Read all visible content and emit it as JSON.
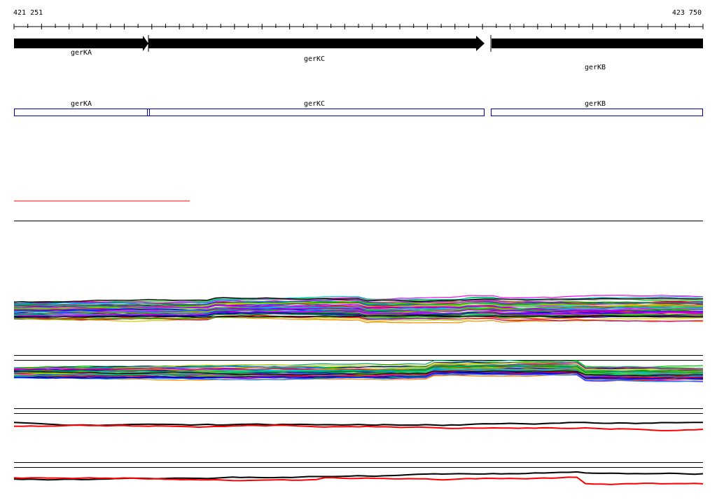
{
  "ruler": {
    "start_label": "421 251",
    "end_label": "423 750"
  },
  "genes": [
    {
      "name": "gerKA",
      "strand": "+"
    },
    {
      "name": "gerKC",
      "strand": "+"
    },
    {
      "name": "gerKB",
      "strand": "-"
    }
  ],
  "cds_track": {
    "labels": [
      "gerKA",
      "gerKC",
      "gerKB"
    ],
    "outline_color": "#0000cc"
  },
  "colors": {
    "gene_arrow": "#000000",
    "highlight_line": "#ff0000",
    "separator": "#000000"
  }
}
